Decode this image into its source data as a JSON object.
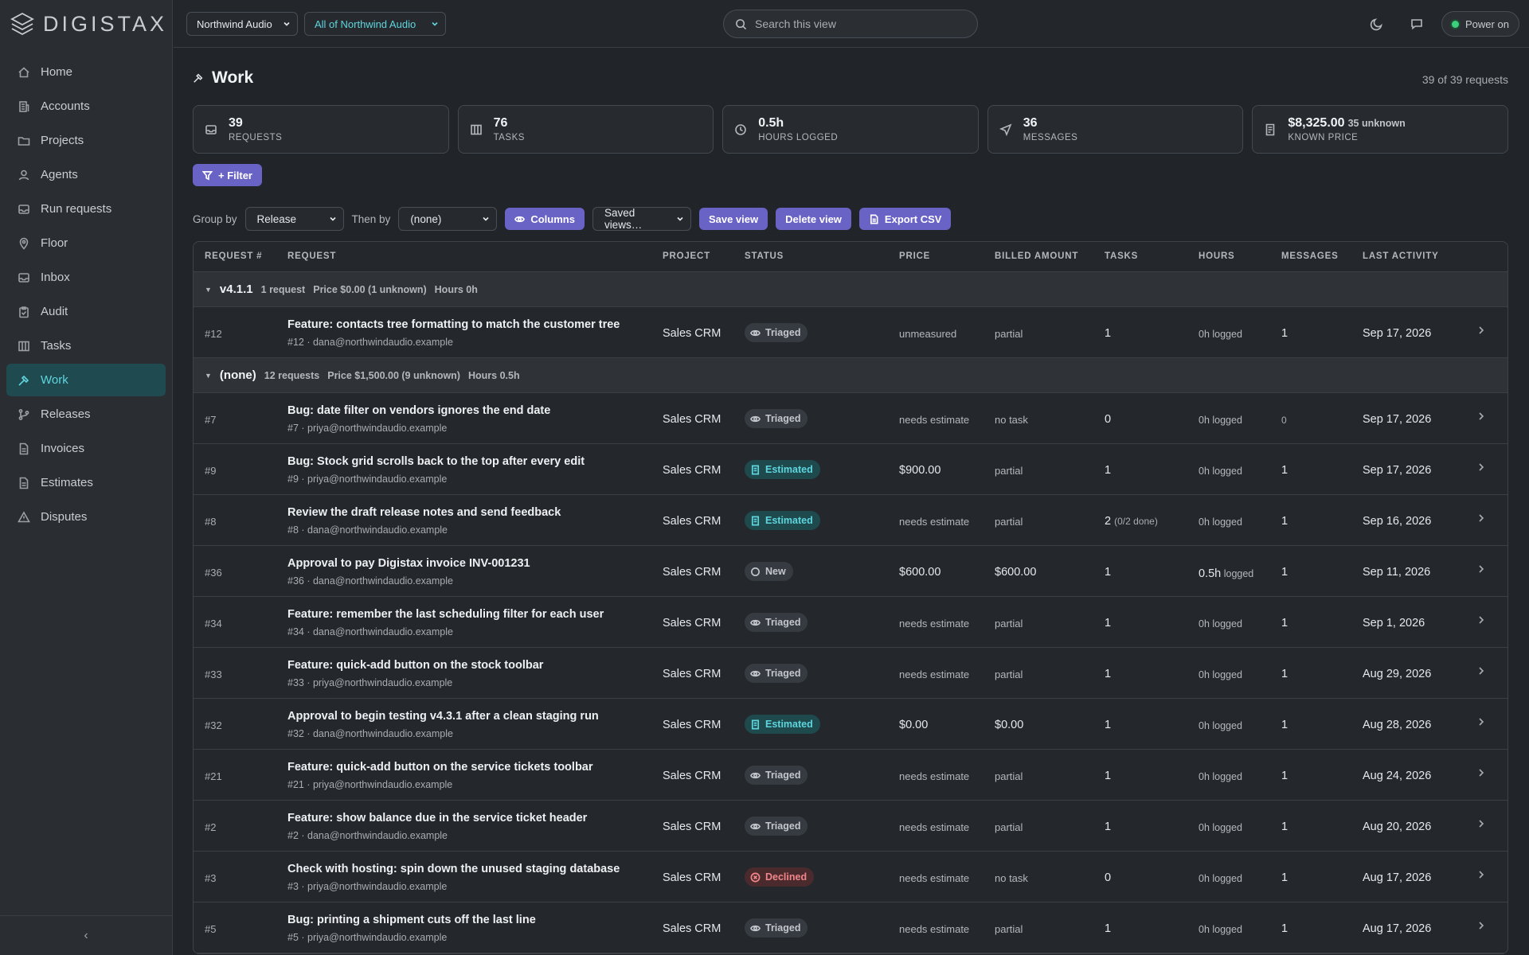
{
  "brand": {
    "name": "DIGISTAX"
  },
  "sidebar": {
    "items": [
      {
        "label": "Home",
        "icon": "home-icon"
      },
      {
        "label": "Accounts",
        "icon": "building-icon"
      },
      {
        "label": "Projects",
        "icon": "folder-icon"
      },
      {
        "label": "Agents",
        "icon": "user-icon"
      },
      {
        "label": "Run requests",
        "icon": "inbox-icon"
      },
      {
        "label": "Floor",
        "icon": "map-pin-icon"
      },
      {
        "label": "Inbox",
        "icon": "inbox-icon"
      },
      {
        "label": "Audit",
        "icon": "clipboard-icon"
      },
      {
        "label": "Tasks",
        "icon": "columns-icon"
      },
      {
        "label": "Work",
        "icon": "hammer-icon",
        "active": true
      },
      {
        "label": "Releases",
        "icon": "git-branch-icon"
      },
      {
        "label": "Invoices",
        "icon": "file-icon"
      },
      {
        "label": "Estimates",
        "icon": "file-icon"
      },
      {
        "label": "Disputes",
        "icon": "alert-triangle-icon"
      }
    ],
    "collapse_glyph": "‹"
  },
  "topbar": {
    "account_select": "Northwind Audio",
    "scope_select": "All of Northwind Audio",
    "search_placeholder": "Search this view",
    "power_label": "Power on"
  },
  "page": {
    "title": "Work",
    "count_text": "39 of 39 requests"
  },
  "stats": [
    {
      "value": "39",
      "label": "REQUESTS",
      "icon": "inbox-icon"
    },
    {
      "value": "76",
      "label": "TASKS",
      "icon": "columns-icon"
    },
    {
      "value": "0.5h",
      "label": "HOURS LOGGED",
      "icon": "clock-icon"
    },
    {
      "value": "36",
      "label": "MESSAGES",
      "icon": "send-icon"
    },
    {
      "value": "$8,325.00",
      "extra": "35 unknown",
      "label": "KNOWN PRICE",
      "icon": "receipt-icon"
    }
  ],
  "toolbar": {
    "filter_label": "+ Filter",
    "group_by_label": "Group by",
    "group_by_value": "Release",
    "then_by_label": "Then by",
    "then_by_value": "(none)",
    "columns_label": "Columns",
    "saved_views_value": "Saved views…",
    "save_view_label": "Save view",
    "delete_view_label": "Delete view",
    "export_label": "Export CSV"
  },
  "table": {
    "columns": [
      "REQUEST #",
      "REQUEST",
      "PROJECT",
      "STATUS",
      "PRICE",
      "BILLED AMOUNT",
      "TASKS",
      "HOURS",
      "MESSAGES",
      "LAST ACTIVITY"
    ],
    "groups": [
      {
        "name": "v4.1.1",
        "count": "1 request",
        "price": "Price $0.00 (1 unknown)",
        "hours": "Hours 0h",
        "rows": [
          {
            "id": "#12",
            "title": "Feature: contacts tree formatting to match the customer tree",
            "sub": "#12 · dana@northwindaudio.example",
            "project": "Sales CRM",
            "status": "Triaged",
            "price": "unmeasured",
            "billed": "partial",
            "tasks": "1",
            "tasks_note": "",
            "hours": "0h logged",
            "messages": "1",
            "last": "Sep 17, 2026"
          }
        ]
      },
      {
        "name": "(none)",
        "count": "12 requests",
        "price": "Price $1,500.00 (9 unknown)",
        "hours": "Hours 0.5h",
        "rows": [
          {
            "id": "#7",
            "title": "Bug: date filter on vendors ignores the end date",
            "sub": "#7 · priya@northwindaudio.example",
            "project": "Sales CRM",
            "status": "Triaged",
            "price": "needs estimate",
            "billed": "no task",
            "tasks": "0",
            "tasks_note": "",
            "hours": "0h logged",
            "messages": "0",
            "last": "Sep 17, 2026"
          },
          {
            "id": "#9",
            "title": "Bug: Stock grid scrolls back to the top after every edit",
            "sub": "#9 · priya@northwindaudio.example",
            "project": "Sales CRM",
            "status": "Estimated",
            "price": "$900.00",
            "billed": "partial",
            "tasks": "1",
            "tasks_note": "",
            "hours": "0h logged",
            "messages": "1",
            "last": "Sep 17, 2026"
          },
          {
            "id": "#8",
            "title": "Review the draft release notes and send feedback",
            "sub": "#8 · dana@northwindaudio.example",
            "project": "Sales CRM",
            "status": "Estimated",
            "price": "needs estimate",
            "billed": "partial",
            "tasks": "2",
            "tasks_note": "(0/2 done)",
            "hours": "0h logged",
            "messages": "1",
            "last": "Sep 16, 2026"
          },
          {
            "id": "#36",
            "title": "Approval to pay Digistax invoice INV-001231",
            "sub": "#36 · dana@northwindaudio.example",
            "project": "Sales CRM",
            "status": "New",
            "price": "$600.00",
            "billed": "$600.00",
            "tasks": "1",
            "tasks_note": "",
            "hours_value": "0.5h",
            "hours": "logged",
            "messages": "1",
            "last": "Sep 11, 2026"
          },
          {
            "id": "#34",
            "title": "Feature: remember the last scheduling filter for each user",
            "sub": "#34 · dana@northwindaudio.example",
            "project": "Sales CRM",
            "status": "Triaged",
            "price": "needs estimate",
            "billed": "partial",
            "tasks": "1",
            "tasks_note": "",
            "hours": "0h logged",
            "messages": "1",
            "last": "Sep 1, 2026"
          },
          {
            "id": "#33",
            "title": "Feature: quick-add button on the stock toolbar",
            "sub": "#33 · priya@northwindaudio.example",
            "project": "Sales CRM",
            "status": "Triaged",
            "price": "needs estimate",
            "billed": "partial",
            "tasks": "1",
            "tasks_note": "",
            "hours": "0h logged",
            "messages": "1",
            "last": "Aug 29, 2026"
          },
          {
            "id": "#32",
            "title": "Approval to begin testing v4.3.1 after a clean staging run",
            "sub": "#32 · dana@northwindaudio.example",
            "project": "Sales CRM",
            "status": "Estimated",
            "price": "$0.00",
            "billed": "$0.00",
            "tasks": "1",
            "tasks_note": "",
            "hours": "0h logged",
            "messages": "1",
            "last": "Aug 28, 2026"
          },
          {
            "id": "#21",
            "title": "Feature: quick-add button on the service tickets toolbar",
            "sub": "#21 · priya@northwindaudio.example",
            "project": "Sales CRM",
            "status": "Triaged",
            "price": "needs estimate",
            "billed": "partial",
            "tasks": "1",
            "tasks_note": "",
            "hours": "0h logged",
            "messages": "1",
            "last": "Aug 24, 2026"
          },
          {
            "id": "#2",
            "title": "Feature: show balance due in the service ticket header",
            "sub": "#2 · dana@northwindaudio.example",
            "project": "Sales CRM",
            "status": "Triaged",
            "price": "needs estimate",
            "billed": "partial",
            "tasks": "1",
            "tasks_note": "",
            "hours": "0h logged",
            "messages": "1",
            "last": "Aug 20, 2026"
          },
          {
            "id": "#3",
            "title": "Check with hosting: spin down the unused staging database",
            "sub": "#3 · priya@northwindaudio.example",
            "project": "Sales CRM",
            "status": "Declined",
            "price": "needs estimate",
            "billed": "no task",
            "tasks": "0",
            "tasks_note": "",
            "hours": "0h logged",
            "messages": "1",
            "last": "Aug 17, 2026"
          },
          {
            "id": "#5",
            "title": "Bug: printing a shipment cuts off the last line",
            "sub": "#5 · priya@northwindaudio.example",
            "project": "Sales CRM",
            "status": "Triaged",
            "price": "needs estimate",
            "billed": "partial",
            "tasks": "1",
            "tasks_note": "",
            "hours": "0h logged",
            "messages": "1",
            "last": "Aug 17, 2026"
          }
        ]
      }
    ]
  },
  "colors": {
    "accent": "#5fd5de",
    "button": "#6a63c6",
    "background": "#212529",
    "sidebar": "#2a2e33",
    "declined": "#f0868a"
  }
}
